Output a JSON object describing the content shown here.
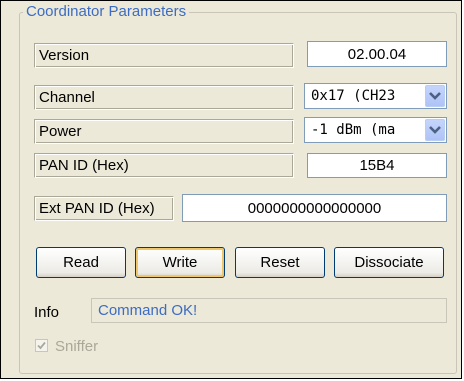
{
  "group": {
    "title": "Coordinator Parameters"
  },
  "fields": {
    "version": {
      "label": "Version",
      "value": "02.00.04"
    },
    "channel": {
      "label": "Channel",
      "value": "0x17 (CH23"
    },
    "power": {
      "label": "Power",
      "value": "-1 dBm (ma"
    },
    "pan_id": {
      "label": "PAN ID (Hex)",
      "value": "15B4"
    },
    "ext_pan_id": {
      "label": "Ext PAN ID (Hex)",
      "value": "0000000000000000"
    }
  },
  "buttons": {
    "read": "Read",
    "write": "Write",
    "reset": "Reset",
    "dissociate": "Dissociate"
  },
  "info": {
    "label": "Info",
    "value": "Command OK!"
  },
  "sniffer": {
    "label": "Sniffer",
    "checked": true,
    "enabled": false
  },
  "colors": {
    "accent": "#3c6cc4",
    "background": "#ece9d8",
    "border": "#7f9db9"
  }
}
